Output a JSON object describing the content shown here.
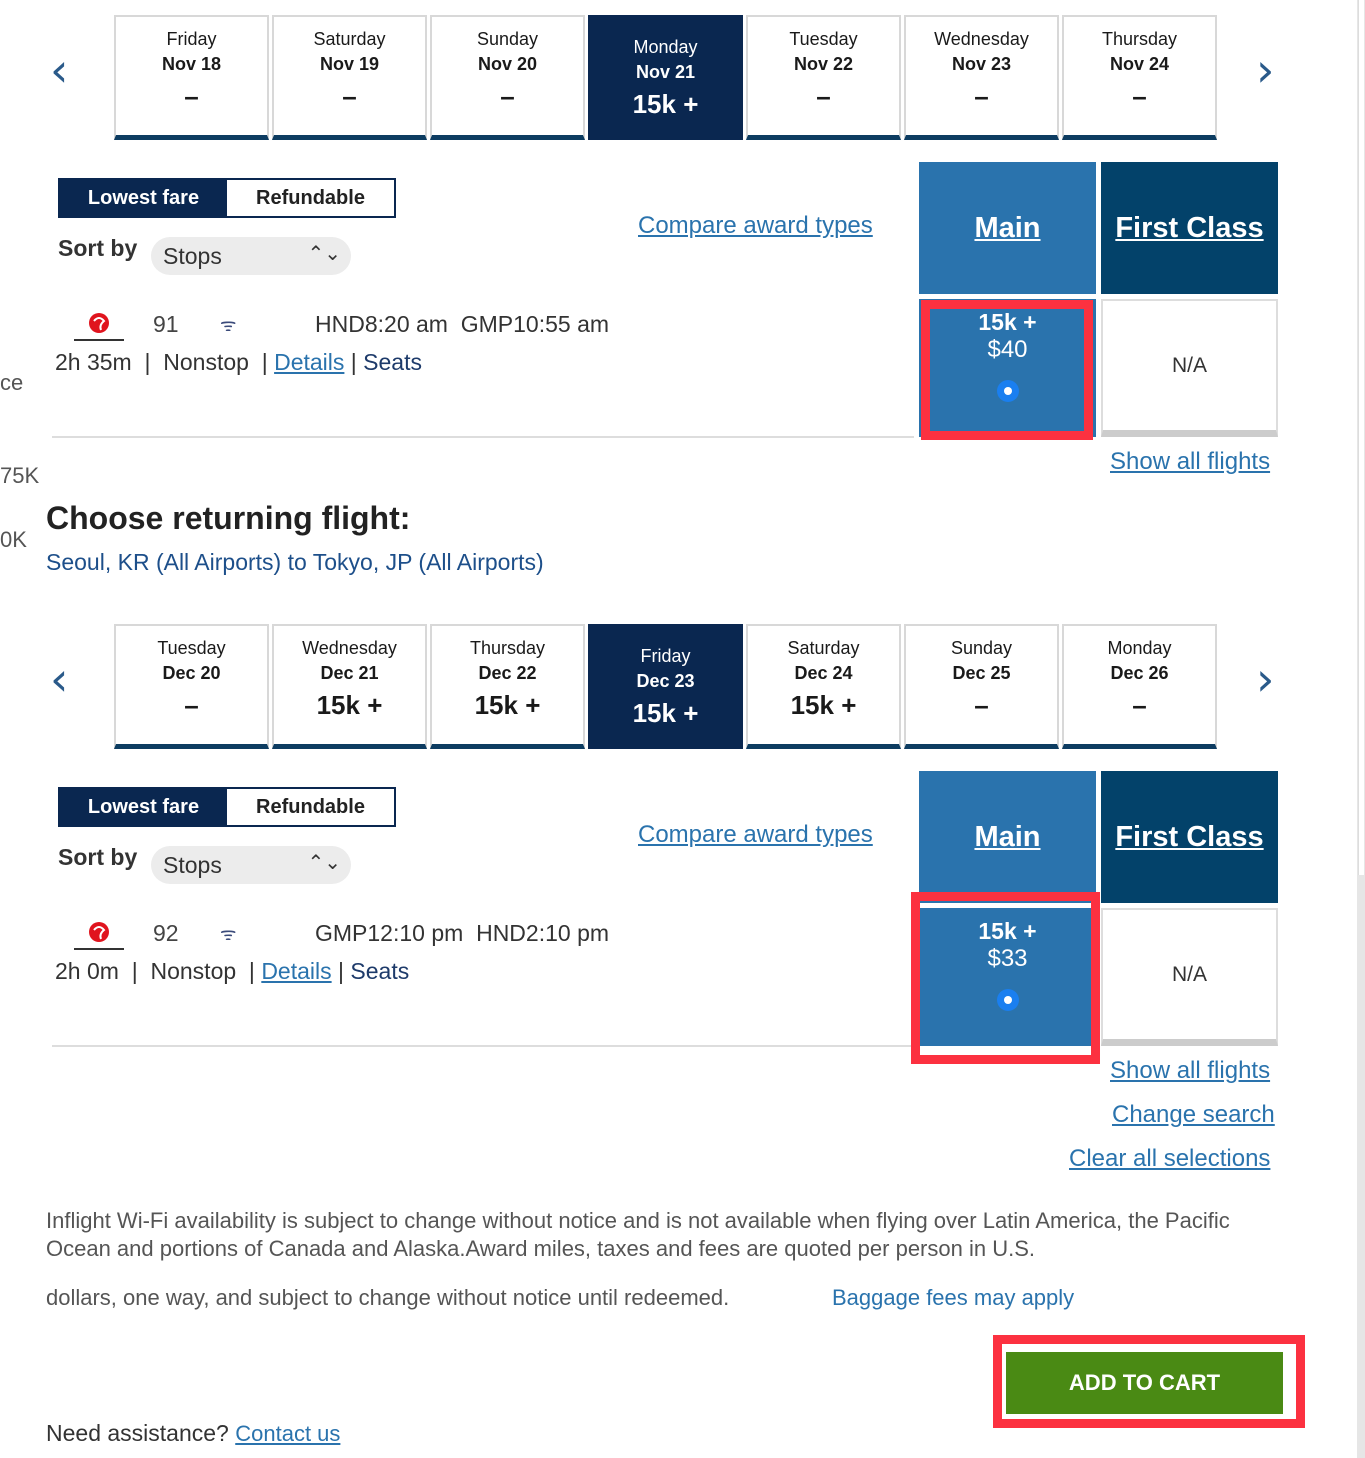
{
  "edge_text": {
    "a": "ce",
    "b": "75K",
    "c": "0K"
  },
  "outbound": {
    "dates": [
      {
        "day": "Friday",
        "date": "Nov 18",
        "price": "–"
      },
      {
        "day": "Saturday",
        "date": "Nov 19",
        "price": "–"
      },
      {
        "day": "Sunday",
        "date": "Nov 20",
        "price": "–"
      },
      {
        "day": "Monday",
        "date": "Nov 21",
        "price": "15k +",
        "selected": true
      },
      {
        "day": "Tuesday",
        "date": "Nov 22",
        "price": "–"
      },
      {
        "day": "Wednesday",
        "date": "Nov 23",
        "price": "–"
      },
      {
        "day": "Thursday",
        "date": "Nov 24",
        "price": "–"
      }
    ],
    "fare_toggle": {
      "lowest": "Lowest fare",
      "refundable": "Refundable"
    },
    "sort_label": "Sort by",
    "sort_value": "Stops",
    "compare": "Compare award types",
    "col_main": "Main",
    "col_first": "First Class",
    "flight": {
      "number": "91",
      "depart_airport": "HND",
      "depart_time": "8:20 am",
      "arrive_airport": "GMP",
      "arrive_time": "10:55 am",
      "duration": "2h 35m",
      "stops": "Nonstop",
      "details": "Details",
      "seats": "Seats",
      "main_points": "15k +",
      "main_price": "$40",
      "first": "N/A"
    },
    "show_all": "Show all flights"
  },
  "returning": {
    "heading": "Choose returning flight:",
    "route": "Seoul, KR (All Airports) to Tokyo, JP (All Airports)",
    "dates": [
      {
        "day": "Tuesday",
        "date": "Dec 20",
        "price": "–"
      },
      {
        "day": "Wednesday",
        "date": "Dec 21",
        "price": "15k +"
      },
      {
        "day": "Thursday",
        "date": "Dec 22",
        "price": "15k +"
      },
      {
        "day": "Friday",
        "date": "Dec 23",
        "price": "15k +",
        "selected": true
      },
      {
        "day": "Saturday",
        "date": "Dec 24",
        "price": "15k +"
      },
      {
        "day": "Sunday",
        "date": "Dec 25",
        "price": "–"
      },
      {
        "day": "Monday",
        "date": "Dec 26",
        "price": "–"
      }
    ],
    "fare_toggle": {
      "lowest": "Lowest fare",
      "refundable": "Refundable"
    },
    "sort_label": "Sort by",
    "sort_value": "Stops",
    "compare": "Compare award types",
    "col_main": "Main",
    "col_first": "First Class",
    "flight": {
      "number": "92",
      "depart_airport": "GMP",
      "depart_time": "12:10 pm",
      "arrive_airport": "HND",
      "arrive_time": "2:10 pm",
      "duration": "2h 0m",
      "stops": "Nonstop",
      "details": "Details",
      "seats": "Seats",
      "main_points": "15k +",
      "main_price": "$33",
      "first": "N/A"
    },
    "show_all": "Show all flights"
  },
  "links": {
    "change_search": "Change search",
    "clear": "Clear all selections"
  },
  "disclaimer": "Inflight Wi-Fi availability is subject to change without notice and is not available when flying over Latin America, the Pacific Ocean and portions of Canada and Alaska.Award miles, taxes and fees are quoted per person in U.S.",
  "disclaimer2": "dollars, one way, and subject to change without notice until redeemed.",
  "baggage": "Baggage fees may apply",
  "add_to_cart": "ADD TO CART",
  "help": {
    "text": "Need assistance?",
    "link": "Contact us"
  },
  "colors": {
    "navy": "#0a2750",
    "main": "#2a73ad",
    "first": "#03426a",
    "highlight": "#fc3140",
    "cart": "#4a8a14"
  }
}
